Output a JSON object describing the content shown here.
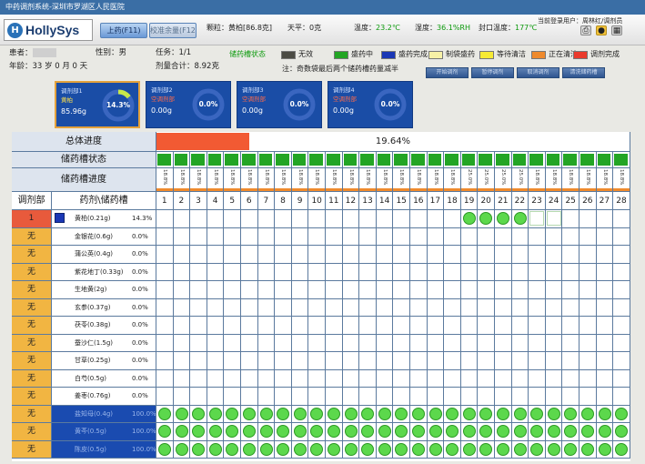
{
  "titlebar": {
    "title": "中药调剂系统-深圳市罗湖区人民医院"
  },
  "logo": {
    "mark": "H",
    "text": "HollySys"
  },
  "tabs": [
    {
      "label": "上药(F11)"
    },
    {
      "label": "校准余量(F12)"
    }
  ],
  "top_status": {
    "granule_label": "颗粒：",
    "granule_value": "黄柏[86.8克]",
    "scale_label": "天平：",
    "scale_value": "0克",
    "temp_label": "温度：",
    "temp_value": "23.2℃",
    "humidity_label": "湿度：",
    "humidity_value": "36.1%RH",
    "seal_label": "封口温度：",
    "seal_value": "177℃",
    "user_label": "当前登录用户：",
    "user_value": "周林红/调剂员"
  },
  "top_icons": [
    "printer-icon",
    "lock-icon",
    "grid-icon"
  ],
  "patient": {
    "name_label": "患者：",
    "gender_label": "性别：",
    "gender_value": "男",
    "task_label": "任务：",
    "task_value": "1/1",
    "age_label": "年龄：",
    "age_value": "33 岁 0 月 0 天",
    "dose_label": "剂量合计：",
    "dose_value": "8.92克"
  },
  "legend": {
    "title": "储药槽状态",
    "items": [
      {
        "label": "无效",
        "color": "#4b4b44"
      },
      {
        "label": "盛药中",
        "color": "#23a524"
      },
      {
        "label": "盛药完成",
        "color": "#1a37b5"
      },
      {
        "label": "制袋盛药",
        "color": "#f7f1a6"
      },
      {
        "label": "等待清洁",
        "color": "#f6ea33"
      },
      {
        "label": "正在清洁",
        "color": "#ef8a2c"
      },
      {
        "label": "调剂完成",
        "color": "#ea3a2c"
      }
    ],
    "note": "注：奇数袋最后两个储药槽药量减半"
  },
  "action_buttons": [
    "开始调剂",
    "暂停调剂",
    "取消调剂",
    "清洗储药槽"
  ],
  "dispensers": [
    {
      "name": "调剂部1",
      "herb": "黄柏",
      "weight": "85.96g",
      "percent": "14.3%",
      "progress": 0.143,
      "selected": true
    },
    {
      "name": "调剂部2",
      "herb": "空调剂部",
      "weight": "0.00g",
      "percent": "0.0%",
      "progress": 0,
      "selected": false
    },
    {
      "name": "调剂部3",
      "herb": "空调剂部",
      "weight": "0.00g",
      "percent": "0.0%",
      "progress": 0,
      "selected": false
    },
    {
      "name": "调剂部4",
      "herb": "空调剂部",
      "weight": "0.00g",
      "percent": "0.0%",
      "progress": 0,
      "selected": false
    }
  ],
  "grid": {
    "overall_label": "总体进度",
    "overall_value": "19.64%",
    "overall_fraction": 0.1964,
    "slot_status_label": "储药槽状态",
    "slot_progress_label": "储药槽进度",
    "dept_header": "调剂部",
    "herb_header": "药剂\\储药槽",
    "columns": [
      "1",
      "2",
      "3",
      "4",
      "5",
      "6",
      "7",
      "8",
      "9",
      "10",
      "11",
      "12",
      "13",
      "14",
      "15",
      "16",
      "17",
      "18",
      "19",
      "20",
      "21",
      "22",
      "23",
      "24",
      "25",
      "26",
      "27",
      "28"
    ],
    "slot_percents": [
      "18.8%",
      "18.8%",
      "18.8%",
      "18.8%",
      "18.8%",
      "18.8%",
      "18.8%",
      "18.8%",
      "18.8%",
      "18.8%",
      "18.8%",
      "18.8%",
      "18.8%",
      "18.8%",
      "18.8%",
      "18.8%",
      "18.8%",
      "18.8%",
      "25.0%",
      "25.0%",
      "25.0%",
      "25.0%",
      "18.8%",
      "18.8%",
      "18.8%",
      "18.8%",
      "18.8%",
      "18.8%"
    ],
    "rows": [
      {
        "dept": "1",
        "herb": "黄柏(0.21g)",
        "pct": "14.3%",
        "active": true,
        "done_slots": [
          19,
          20,
          21,
          22
        ],
        "empty_slots": [
          23,
          24
        ]
      },
      {
        "dept": "无",
        "herb": "金银花(0.6g)",
        "pct": "0.0%"
      },
      {
        "dept": "无",
        "herb": "蒲公英(0.4g)",
        "pct": "0.0%"
      },
      {
        "dept": "无",
        "herb": "紫花地丁(0.33g)",
        "pct": "0.0%"
      },
      {
        "dept": "无",
        "herb": "生地黄(2g)",
        "pct": "0.0%"
      },
      {
        "dept": "无",
        "herb": "玄参(0.37g)",
        "pct": "0.0%"
      },
      {
        "dept": "无",
        "herb": "茯苓(0.38g)",
        "pct": "0.0%"
      },
      {
        "dept": "无",
        "herb": "蚕沙仁(1.5g)",
        "pct": "0.0%"
      },
      {
        "dept": "无",
        "herb": "甘草(0.25g)",
        "pct": "0.0%"
      },
      {
        "dept": "无",
        "herb": "白芍(0.5g)",
        "pct": "0.0%"
      },
      {
        "dept": "无",
        "herb": "姜枣(0.76g)",
        "pct": "0.0%"
      },
      {
        "dept": "无",
        "herb": "盐知母(0.4g)",
        "pct": "100.0%",
        "complete": true
      },
      {
        "dept": "无",
        "herb": "黄芩(0.5g)",
        "pct": "100.0%",
        "complete": true
      },
      {
        "dept": "无",
        "herb": "陈皮(0.5g)",
        "pct": "100.0%",
        "complete": true
      }
    ]
  }
}
